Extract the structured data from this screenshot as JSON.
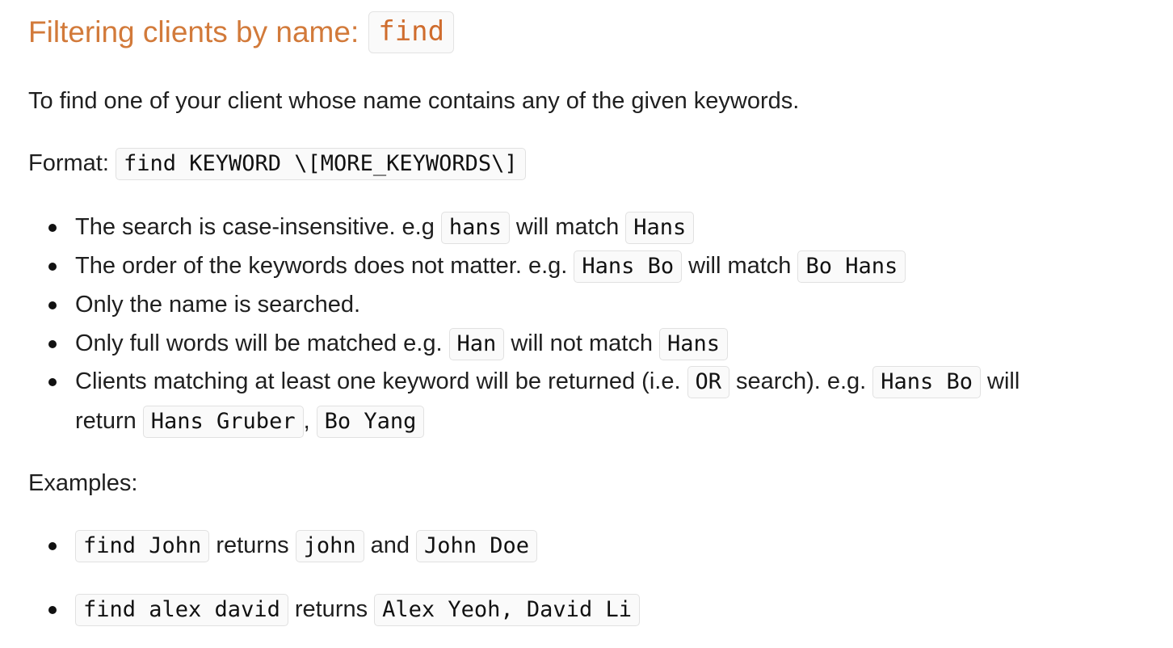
{
  "heading": {
    "text": "Filtering clients by name: ",
    "code": "find"
  },
  "intro": "To find one of your client whose name contains any of the given keywords.",
  "format": {
    "label": "Format: ",
    "code": "find KEYWORD \\[MORE_KEYWORDS\\]"
  },
  "rules": {
    "r1": {
      "a": "The search is case-insensitive. e.g",
      "c1": "hans",
      "b": "will match",
      "c2": "Hans"
    },
    "r2": {
      "a": "The order of the keywords does not matter. e.g.",
      "c1": "Hans Bo",
      "b": "will match",
      "c2": "Bo Hans"
    },
    "r3": {
      "a": "Only the name is searched."
    },
    "r4": {
      "a": "Only full words will be matched e.g.",
      "c1": "Han",
      "b": "will not match",
      "c2": "Hans"
    },
    "r5": {
      "a": "Clients matching at least one keyword will be returned (i.e.",
      "c1": "OR",
      "b": "search). e.g.",
      "c2": "Hans Bo",
      "d": "will",
      "e": "return",
      "c3": "Hans Gruber",
      "f": ",",
      "c4": "Bo Yang"
    }
  },
  "examples_label": "Examples:",
  "examples": {
    "e1": {
      "c1": "find John",
      "a": "returns",
      "c2": "john",
      "b": "and",
      "c3": "John Doe"
    },
    "e2": {
      "c1": "find alex david",
      "a": "returns",
      "c2": "Alex Yeoh, David Li"
    }
  }
}
